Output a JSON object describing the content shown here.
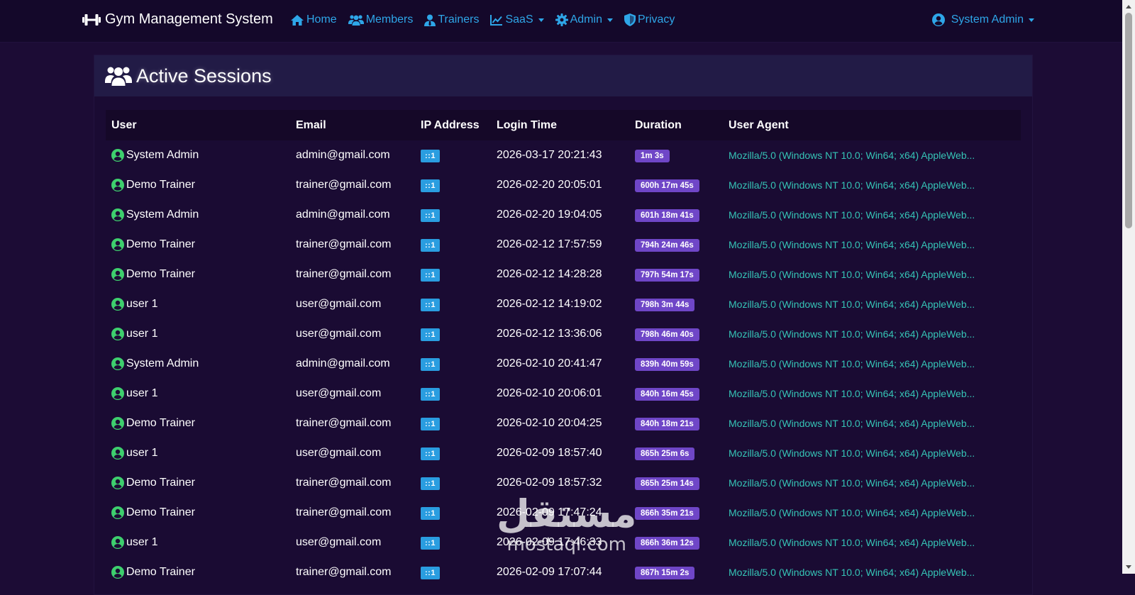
{
  "navbar": {
    "brand": "Gym Management System",
    "links": [
      {
        "label": "Home",
        "icon": "home-icon",
        "dropdown": false
      },
      {
        "label": "Members",
        "icon": "users-icon",
        "dropdown": false
      },
      {
        "label": "Trainers",
        "icon": "user-tie-icon",
        "dropdown": false
      },
      {
        "label": "SaaS",
        "icon": "chart-line-icon",
        "dropdown": true
      },
      {
        "label": "Admin",
        "icon": "gear-icon",
        "dropdown": true
      },
      {
        "label": "Privacy",
        "icon": "shield-icon",
        "dropdown": false
      }
    ],
    "user_menu": "System Admin"
  },
  "page": {
    "title": "Active Sessions"
  },
  "table": {
    "headers": [
      "User",
      "Email",
      "IP Address",
      "Login Time",
      "Duration",
      "User Agent"
    ],
    "rows": [
      {
        "user": "System Admin",
        "email": "admin@gmail.com",
        "ip": "::1",
        "login": "2026-03-17 20:21:43",
        "duration": "1m 3s",
        "ua": "Mozilla/5.0 (Windows NT 10.0; Win64; x64) AppleWeb..."
      },
      {
        "user": "Demo Trainer",
        "email": "trainer@gmail.com",
        "ip": "::1",
        "login": "2026-02-20 20:05:01",
        "duration": "600h 17m 45s",
        "ua": "Mozilla/5.0 (Windows NT 10.0; Win64; x64) AppleWeb..."
      },
      {
        "user": "System Admin",
        "email": "admin@gmail.com",
        "ip": "::1",
        "login": "2026-02-20 19:04:05",
        "duration": "601h 18m 41s",
        "ua": "Mozilla/5.0 (Windows NT 10.0; Win64; x64) AppleWeb..."
      },
      {
        "user": "Demo Trainer",
        "email": "trainer@gmail.com",
        "ip": "::1",
        "login": "2026-02-12 17:57:59",
        "duration": "794h 24m 46s",
        "ua": "Mozilla/5.0 (Windows NT 10.0; Win64; x64) AppleWeb..."
      },
      {
        "user": "Demo Trainer",
        "email": "trainer@gmail.com",
        "ip": "::1",
        "login": "2026-02-12 14:28:28",
        "duration": "797h 54m 17s",
        "ua": "Mozilla/5.0 (Windows NT 10.0; Win64; x64) AppleWeb..."
      },
      {
        "user": "user 1",
        "email": "user@gmail.com",
        "ip": "::1",
        "login": "2026-02-12 14:19:02",
        "duration": "798h 3m 44s",
        "ua": "Mozilla/5.0 (Windows NT 10.0; Win64; x64) AppleWeb..."
      },
      {
        "user": "user 1",
        "email": "user@gmail.com",
        "ip": "::1",
        "login": "2026-02-12 13:36:06",
        "duration": "798h 46m 40s",
        "ua": "Mozilla/5.0 (Windows NT 10.0; Win64; x64) AppleWeb..."
      },
      {
        "user": "System Admin",
        "email": "admin@gmail.com",
        "ip": "::1",
        "login": "2026-02-10 20:41:47",
        "duration": "839h 40m 59s",
        "ua": "Mozilla/5.0 (Windows NT 10.0; Win64; x64) AppleWeb..."
      },
      {
        "user": "user 1",
        "email": "user@gmail.com",
        "ip": "::1",
        "login": "2026-02-10 20:06:01",
        "duration": "840h 16m 45s",
        "ua": "Mozilla/5.0 (Windows NT 10.0; Win64; x64) AppleWeb..."
      },
      {
        "user": "Demo Trainer",
        "email": "trainer@gmail.com",
        "ip": "::1",
        "login": "2026-02-10 20:04:25",
        "duration": "840h 18m 21s",
        "ua": "Mozilla/5.0 (Windows NT 10.0; Win64; x64) AppleWeb..."
      },
      {
        "user": "user 1",
        "email": "user@gmail.com",
        "ip": "::1",
        "login": "2026-02-09 18:57:40",
        "duration": "865h 25m 6s",
        "ua": "Mozilla/5.0 (Windows NT 10.0; Win64; x64) AppleWeb..."
      },
      {
        "user": "Demo Trainer",
        "email": "trainer@gmail.com",
        "ip": "::1",
        "login": "2026-02-09 18:57:32",
        "duration": "865h 25m 14s",
        "ua": "Mozilla/5.0 (Windows NT 10.0; Win64; x64) AppleWeb..."
      },
      {
        "user": "Demo Trainer",
        "email": "trainer@gmail.com",
        "ip": "::1",
        "login": "2026-02-09 17:47:24",
        "duration": "866h 35m 21s",
        "ua": "Mozilla/5.0 (Windows NT 10.0; Win64; x64) AppleWeb..."
      },
      {
        "user": "user 1",
        "email": "user@gmail.com",
        "ip": "::1",
        "login": "2026-02-09 17:46:33",
        "duration": "866h 36m 12s",
        "ua": "Mozilla/5.0 (Windows NT 10.0; Win64; x64) AppleWeb..."
      },
      {
        "user": "Demo Trainer",
        "email": "trainer@gmail.com",
        "ip": "::1",
        "login": "2026-02-09 17:07:44",
        "duration": "867h 15m 2s",
        "ua": "Mozilla/5.0 (Windows NT 10.0; Win64; x64) AppleWeb..."
      }
    ]
  },
  "watermark": {
    "arabic": "مستقل",
    "latin": "mostaql.com"
  },
  "colors": {
    "background": "#1c0c35",
    "navbar": "#14082a",
    "link": "#2ea6e8",
    "ip_badge": "#2a9de0",
    "duration_badge": "#6f46c7",
    "user_agent": "#35c4b6",
    "user_status_icon": "#3ecf6e"
  }
}
